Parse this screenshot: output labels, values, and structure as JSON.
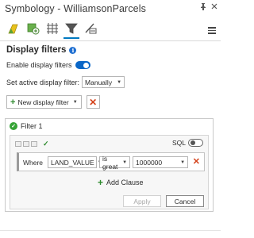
{
  "window": {
    "title": "Symbology - WilliamsonParcels",
    "pin_glyph": "⭡",
    "close_glyph": "✕"
  },
  "toolbar": {
    "tabs": [
      {
        "name": "primary-symbology-icon"
      },
      {
        "name": "vary-symbology-icon"
      },
      {
        "name": "symbol-layers-icon"
      },
      {
        "name": "display-filters-icon",
        "active": true
      },
      {
        "name": "symbol-layer-drawing-icon"
      }
    ]
  },
  "heading": {
    "label": "Display filters",
    "info_glyph": "i"
  },
  "enable": {
    "label": "Enable display filters",
    "on": true
  },
  "active_filter": {
    "label": "Set active display filter:",
    "value": "Manually"
  },
  "new_filter": {
    "label": "New display filter",
    "delete_glyph": "✕"
  },
  "filter": {
    "name": "Filter 1",
    "sql_label": "SQL",
    "clause": {
      "where": "Where",
      "field": "LAND_VALUE",
      "operator": "is great",
      "value": "1000000",
      "remove_glyph": "✕"
    },
    "add_clause_label": "Add Clause",
    "apply_label": "Apply",
    "cancel_label": "Cancel"
  }
}
